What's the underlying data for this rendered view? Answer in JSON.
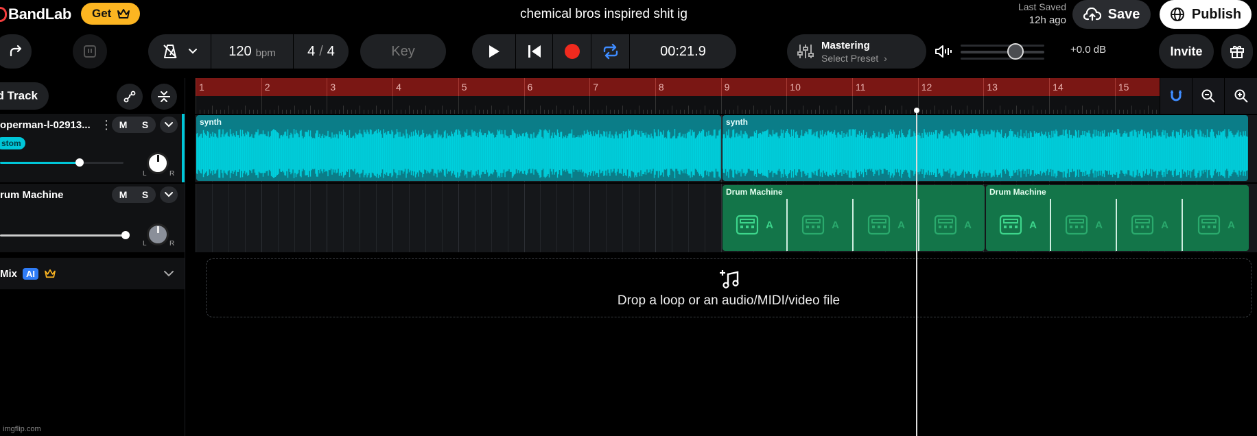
{
  "header": {
    "logo_text": "BandLab",
    "get_label": "Get",
    "project_title": "chemical bros inspired shit ig",
    "last_saved_label": "Last Saved",
    "last_saved_time": "12h ago",
    "save_label": "Save",
    "publish_label": "Publish"
  },
  "toolbar": {
    "tempo_value": "120",
    "tempo_unit": "bpm",
    "time_sig_top": "4",
    "time_sig_sep": "/",
    "time_sig_bottom": "4",
    "key_label": "Key",
    "time_display": "00:21.9",
    "mastering_title": "Mastering",
    "mastering_preset": "Select Preset",
    "volume_db": "+0.0 dB",
    "invite_label": "Invite"
  },
  "tracks_panel": {
    "add_track_label": "d Track",
    "tracks": [
      {
        "name": "operman-l-02913...",
        "mute": "M",
        "solo": "S",
        "tag": "stom"
      },
      {
        "name": "rum Machine",
        "mute": "M",
        "solo": "S"
      }
    ],
    "pan_left": "L",
    "pan_right": "R",
    "mix_label": "Mix",
    "ai_badge": "AI"
  },
  "timeline": {
    "bars": [
      "1",
      "2",
      "3",
      "4",
      "5",
      "6",
      "7",
      "8",
      "9",
      "10",
      "11",
      "12",
      "13",
      "14",
      "15"
    ],
    "synth_clips": [
      {
        "label": "synth"
      },
      {
        "label": "synth"
      }
    ],
    "drum_clips": [
      {
        "label": "Drum Machine"
      },
      {
        "label": "Drum Machine"
      }
    ],
    "pattern_letter": "A",
    "drop_text": "Drop a loop or an audio/MIDI/video file"
  },
  "colors": {
    "accent_get": "#fcb521",
    "ruler": "#7a1714",
    "synth_clip": "#0b7d88",
    "synth_wave": "#00d0dd",
    "drum_clip": "#137549",
    "record": "#f02a1e",
    "loop": "#3f8cff"
  },
  "watermark": "imgflip.com"
}
